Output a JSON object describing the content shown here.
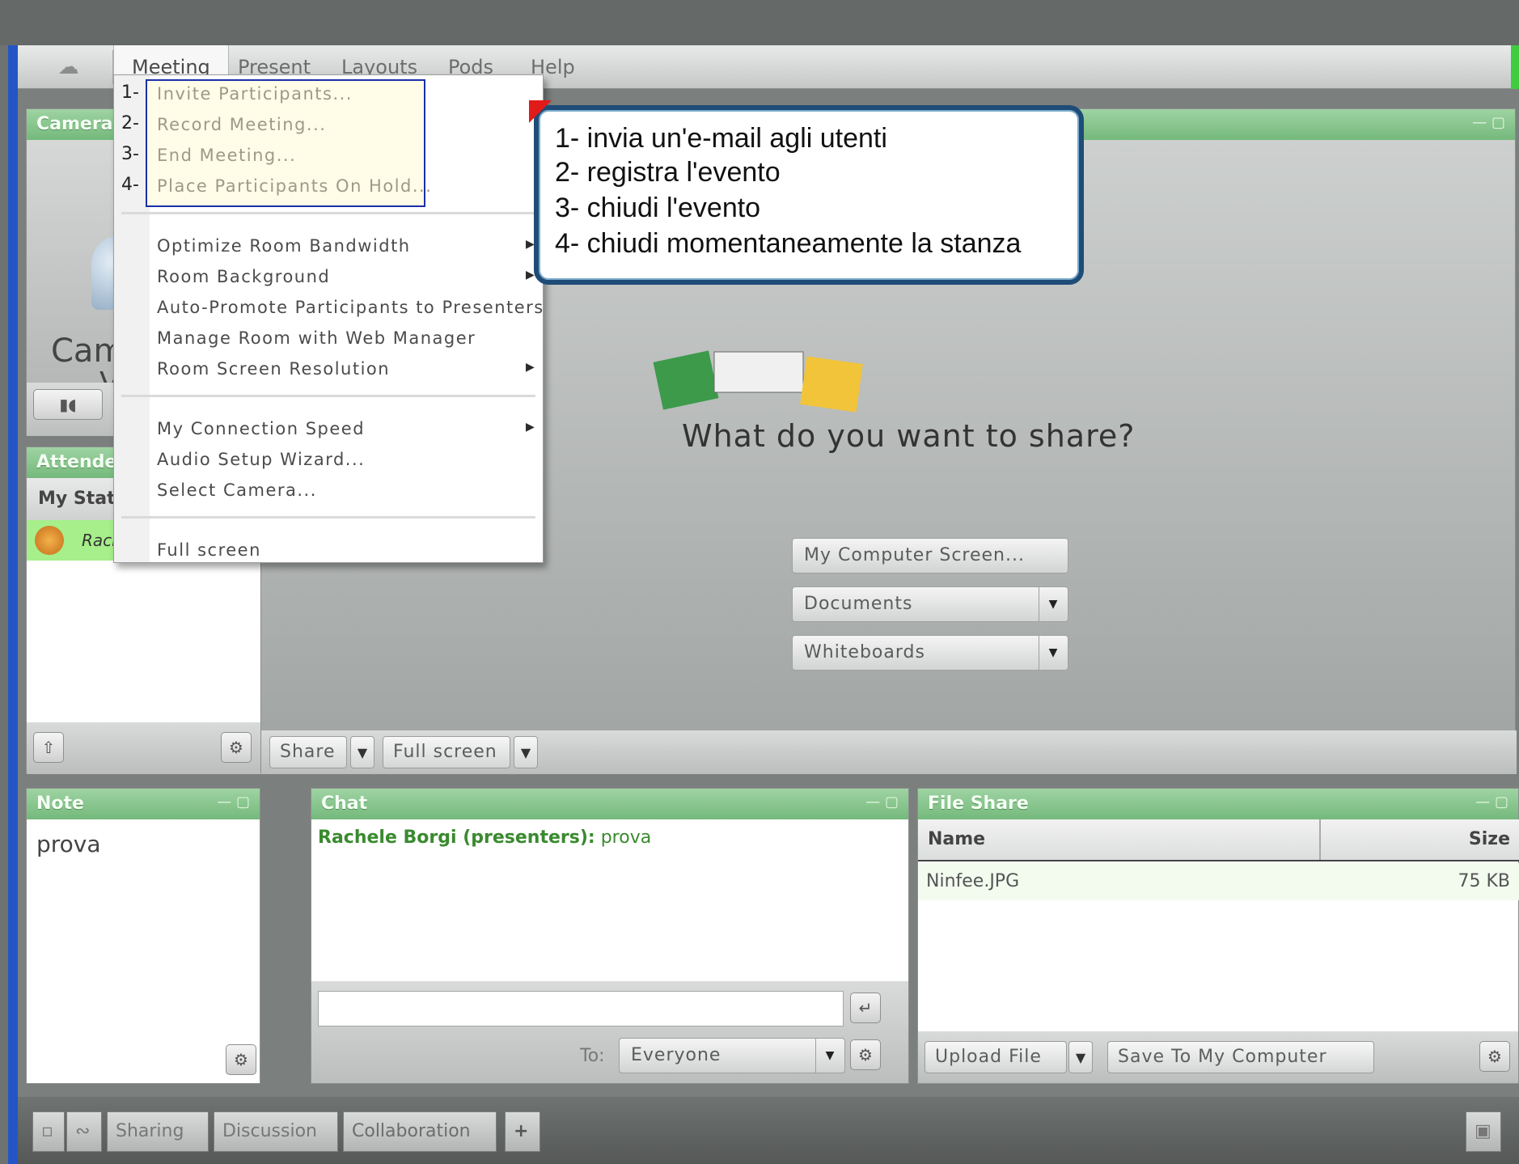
{
  "menubar": {
    "logo_icon": "cloud-logo-icon",
    "items": [
      {
        "label": "Meeting"
      },
      {
        "label": "Present"
      },
      {
        "label": "Layouts"
      },
      {
        "label": "Pods"
      },
      {
        "label": "Help"
      }
    ]
  },
  "meeting_menu": {
    "numbers": [
      "1-",
      "2-",
      "3-",
      "4-"
    ],
    "group1": [
      "Invite Participants...",
      "Record Meeting...",
      "End Meeting...",
      "Place Participants On Hold..."
    ],
    "group2": [
      "Optimize Room Bandwidth",
      "Room Background",
      "Auto-Promote Participants to Presenters",
      "Manage Room with Web Manager",
      "Room Screen Resolution"
    ],
    "group3": [
      "My Connection Speed",
      "Audio Setup Wizard...",
      "Select Camera..."
    ],
    "group4": [
      "Full screen"
    ]
  },
  "callout": {
    "lines": [
      "1- invia un'e-mail agli utenti",
      "2- registra l'evento",
      "3- chiudi l'evento",
      "4- chiudi momentaneamente la stanza"
    ]
  },
  "camera_pod": {
    "title": "Camera",
    "label": "Cam",
    "label2": "V"
  },
  "attendees_pod": {
    "title": "Attendee",
    "status_label": "My Statu",
    "attendee": "Rach"
  },
  "share_pod": {
    "question": "What do you want to share?",
    "screen_button": "My Computer Screen...",
    "documents_dropdown": "Documents",
    "whiteboards_dropdown": "Whiteboards",
    "share_button": "Share",
    "fullscreen_button": "Full screen"
  },
  "note_pod": {
    "title": "Note",
    "text": "prova"
  },
  "chat_pod": {
    "title": "Chat",
    "message_sender": "Rachele Borgi (presenters):",
    "message_text": "prova",
    "to_label": "To:",
    "to_value": "Everyone"
  },
  "fileshare_pod": {
    "title": "File Share",
    "col_name": "Name",
    "col_size": "Size",
    "files": [
      {
        "name": "Ninfee.JPG",
        "size": "75 KB"
      }
    ],
    "upload_button": "Upload File",
    "save_button": "Save To My Computer"
  },
  "bottombar": {
    "tabs": [
      "Sharing",
      "Discussion",
      "Collaboration"
    ],
    "add_label": "+"
  }
}
